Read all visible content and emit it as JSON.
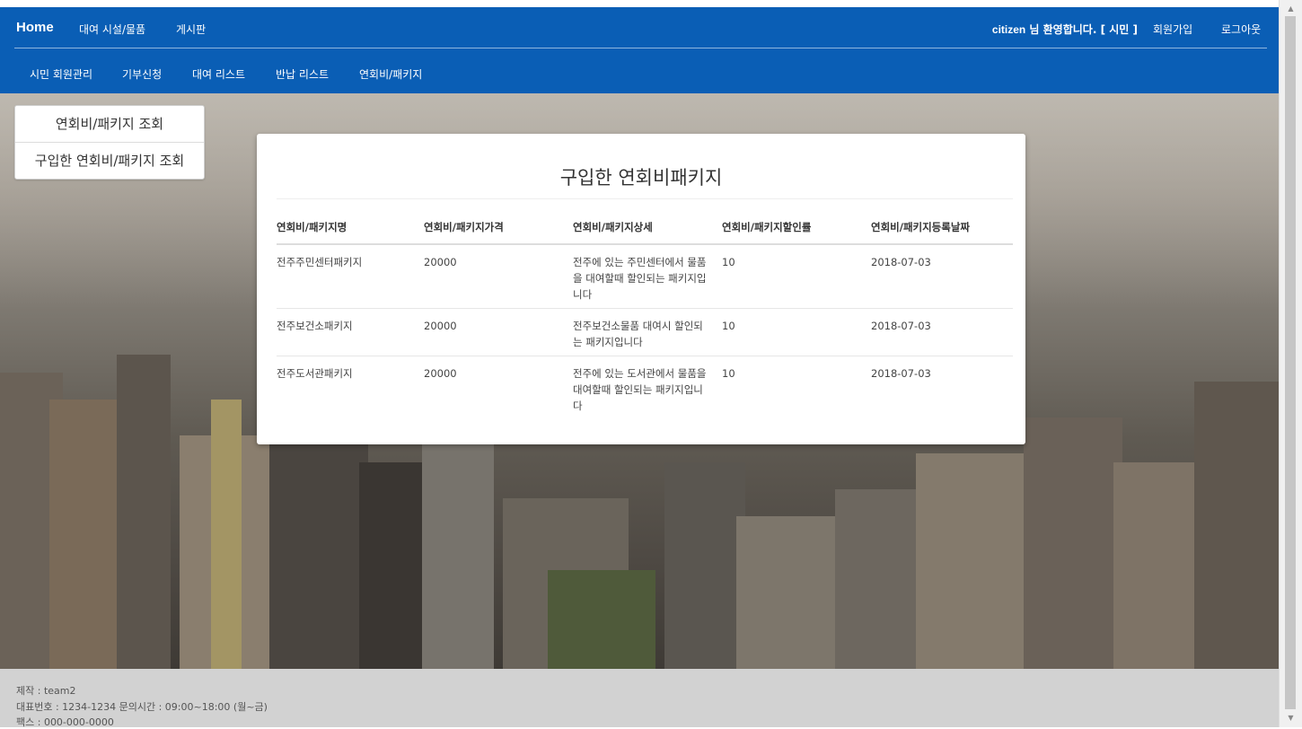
{
  "nav": {
    "home": "Home",
    "links": [
      "대여 시설/물품",
      "게시판"
    ],
    "welcome_user": "citizen",
    "welcome_text": " 님 환영합니다. [ 시민 ]",
    "signup": "회원가입",
    "logout": "로그아웃",
    "sub_links": [
      "시민 회원관리",
      "기부신청",
      "대여 리스트",
      "반납 리스트",
      "연회비/패키지"
    ]
  },
  "side_menu": [
    "연회비/패키지 조회",
    "구입한 연회비/패키지 조회"
  ],
  "panel": {
    "title": "구입한 연회비패키지",
    "headers": [
      "연회비/패키지명",
      "연회비/패키지가격",
      "연회비/패키지상세",
      "연회비/패키지할인률",
      "연회비/패키지등록날짜"
    ],
    "rows": [
      [
        "전주주민센터패키지",
        "20000",
        "전주에 있는 주민센터에서 물품을 대여할때 할인되는 패키지입니다",
        "10",
        "2018-07-03"
      ],
      [
        "전주보건소패키지",
        "20000",
        "전주보건소물품 대여시 할인되는 패키지입니다",
        "10",
        "2018-07-03"
      ],
      [
        "전주도서관패키지",
        "20000",
        "전주에 있는 도서관에서 물품을 대여할때 할인되는 패키지입니다",
        "10",
        "2018-07-03"
      ]
    ]
  },
  "footer": {
    "maker": "제작 : team2",
    "phone": "대표번호 : 1234-1234 문의시간 : 09:00~18:00 (월~금)",
    "fax": "팩스 : 000-000-0000"
  },
  "colors": {
    "nav_bg": "#0a5eb5",
    "footer_bg": "#d2d2d2"
  }
}
